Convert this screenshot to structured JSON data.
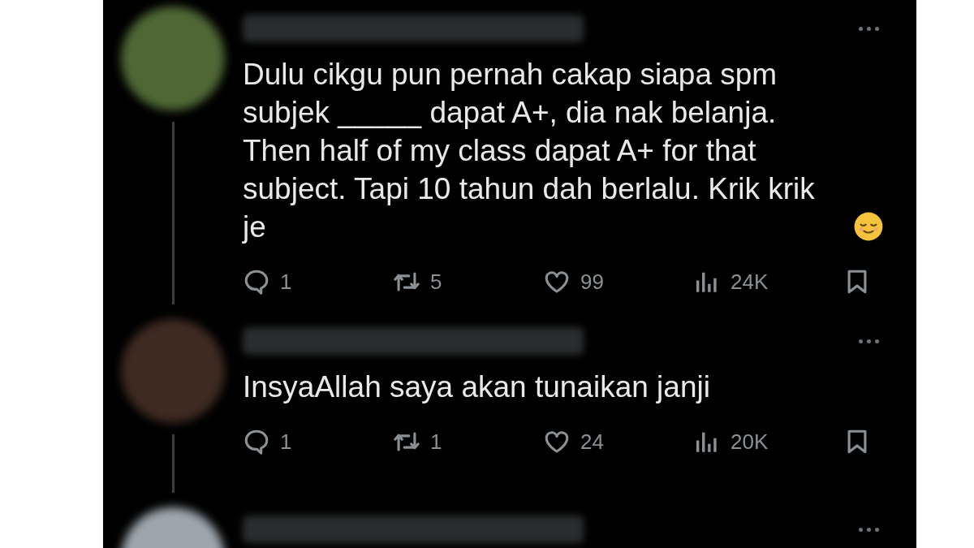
{
  "tweets": [
    {
      "kind": "full",
      "text": "Dulu cikgu pun pernah cakap siapa spm subjek _____ dapat A+, dia nak belanja. Then half of my class dapat A+ for that subject. Tapi 10 tahun dah berlalu. Krik krik je",
      "emoji": true,
      "stats": {
        "replies": "1",
        "reposts": "5",
        "likes": "99",
        "views": "24K"
      }
    },
    {
      "kind": "full",
      "text": "InsyaAllah saya akan tunaikan janji",
      "emoji": false,
      "stats": {
        "replies": "1",
        "reposts": "1",
        "likes": "24",
        "views": "20K"
      }
    },
    {
      "kind": "cut"
    }
  ]
}
